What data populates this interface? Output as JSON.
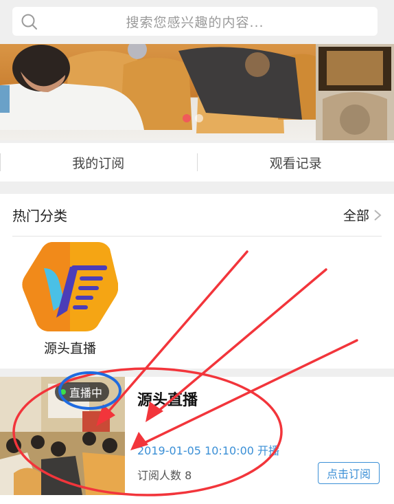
{
  "search": {
    "placeholder": "搜索您感兴趣的内容..."
  },
  "banner": {
    "dots": 2,
    "active_dot": 0
  },
  "tabs": [
    {
      "label": "我的订阅"
    },
    {
      "label": "观看记录"
    }
  ],
  "hot": {
    "title": "热门分类",
    "all_label": "全部",
    "categories": [
      {
        "label": "源头直播",
        "icon": "yt-logo"
      }
    ]
  },
  "live_card": {
    "badge": "直播中",
    "title": "源头直播",
    "time": "2019-01-05 10:10:00 开播",
    "subscribers": "订阅人数 8",
    "subscribe_label": "点击订阅"
  },
  "colors": {
    "accent": "#3a8fd6",
    "live_dot": "#3be04b",
    "annotation": "#f2353b",
    "circle_highlight": "#1f6be0"
  }
}
